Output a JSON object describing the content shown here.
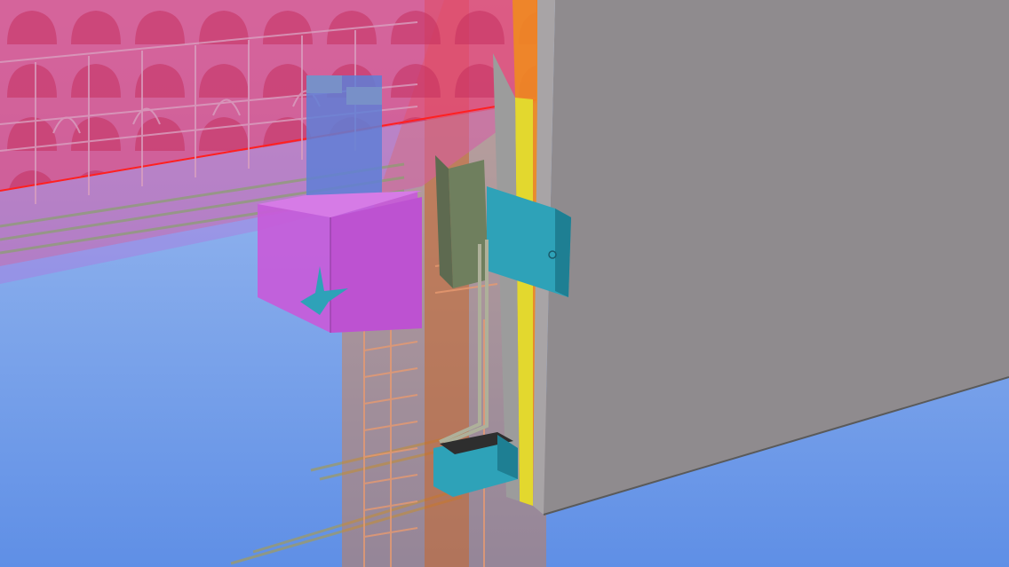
{
  "colors": {
    "sky_top": "#a7c3f0",
    "sky_bottom": "#5f8fe6",
    "slab": "#e8407a",
    "slab_edge": "#ff2020",
    "column": "#e07a2e",
    "column_core": "#c8662a",
    "panel_face": "#8f8b8e",
    "panel_edge": "#a8a4a6",
    "insulation": "#e3d82e",
    "insulation_edge": "#f08a20",
    "bracket": "#2ea2b8",
    "bracket_dark": "#1e7f93",
    "corbel": "#c75bd9",
    "bearing_pad": "#5f7fd6",
    "plate": "#6f7f5e",
    "rebar": "#9a9a6e"
  },
  "scene": {
    "elements": [
      "precast-slab",
      "concrete-column",
      "facade-panel",
      "insulation-layer",
      "steel-bracket-upper",
      "steel-bracket-lower",
      "corbel",
      "bearing-pad",
      "embed-plate",
      "rebar-cage"
    ]
  }
}
